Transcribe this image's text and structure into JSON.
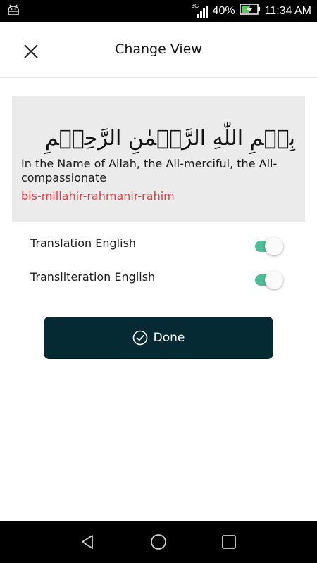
{
  "status_bar": {
    "network_type": "3G",
    "battery_percent": "40%",
    "time": "11:34 AM"
  },
  "header": {
    "title": "Change View",
    "close_icon": "close-icon"
  },
  "preview": {
    "arabic": "بِسۡمِ اللّٰهِ الرَّحۡمٰنِ الرَّحِيۡمِ",
    "translation": "In the Name of Allah, the All-merciful, the All-compassionate",
    "transliteration": "bis-millahir-rahmanir-rahim",
    "transliteration_color": "#ea3b3b"
  },
  "options": [
    {
      "label": "Translation English",
      "enabled": true
    },
    {
      "label": "Transliteration English",
      "enabled": true
    }
  ],
  "toggle_color": "#4dbf96",
  "done_button": {
    "label": "Done",
    "icon": "check-circle-icon",
    "color": "#062a33"
  },
  "nav_bar": {
    "icons": [
      "back-triangle-icon",
      "home-circle-icon",
      "recents-square-icon"
    ]
  }
}
